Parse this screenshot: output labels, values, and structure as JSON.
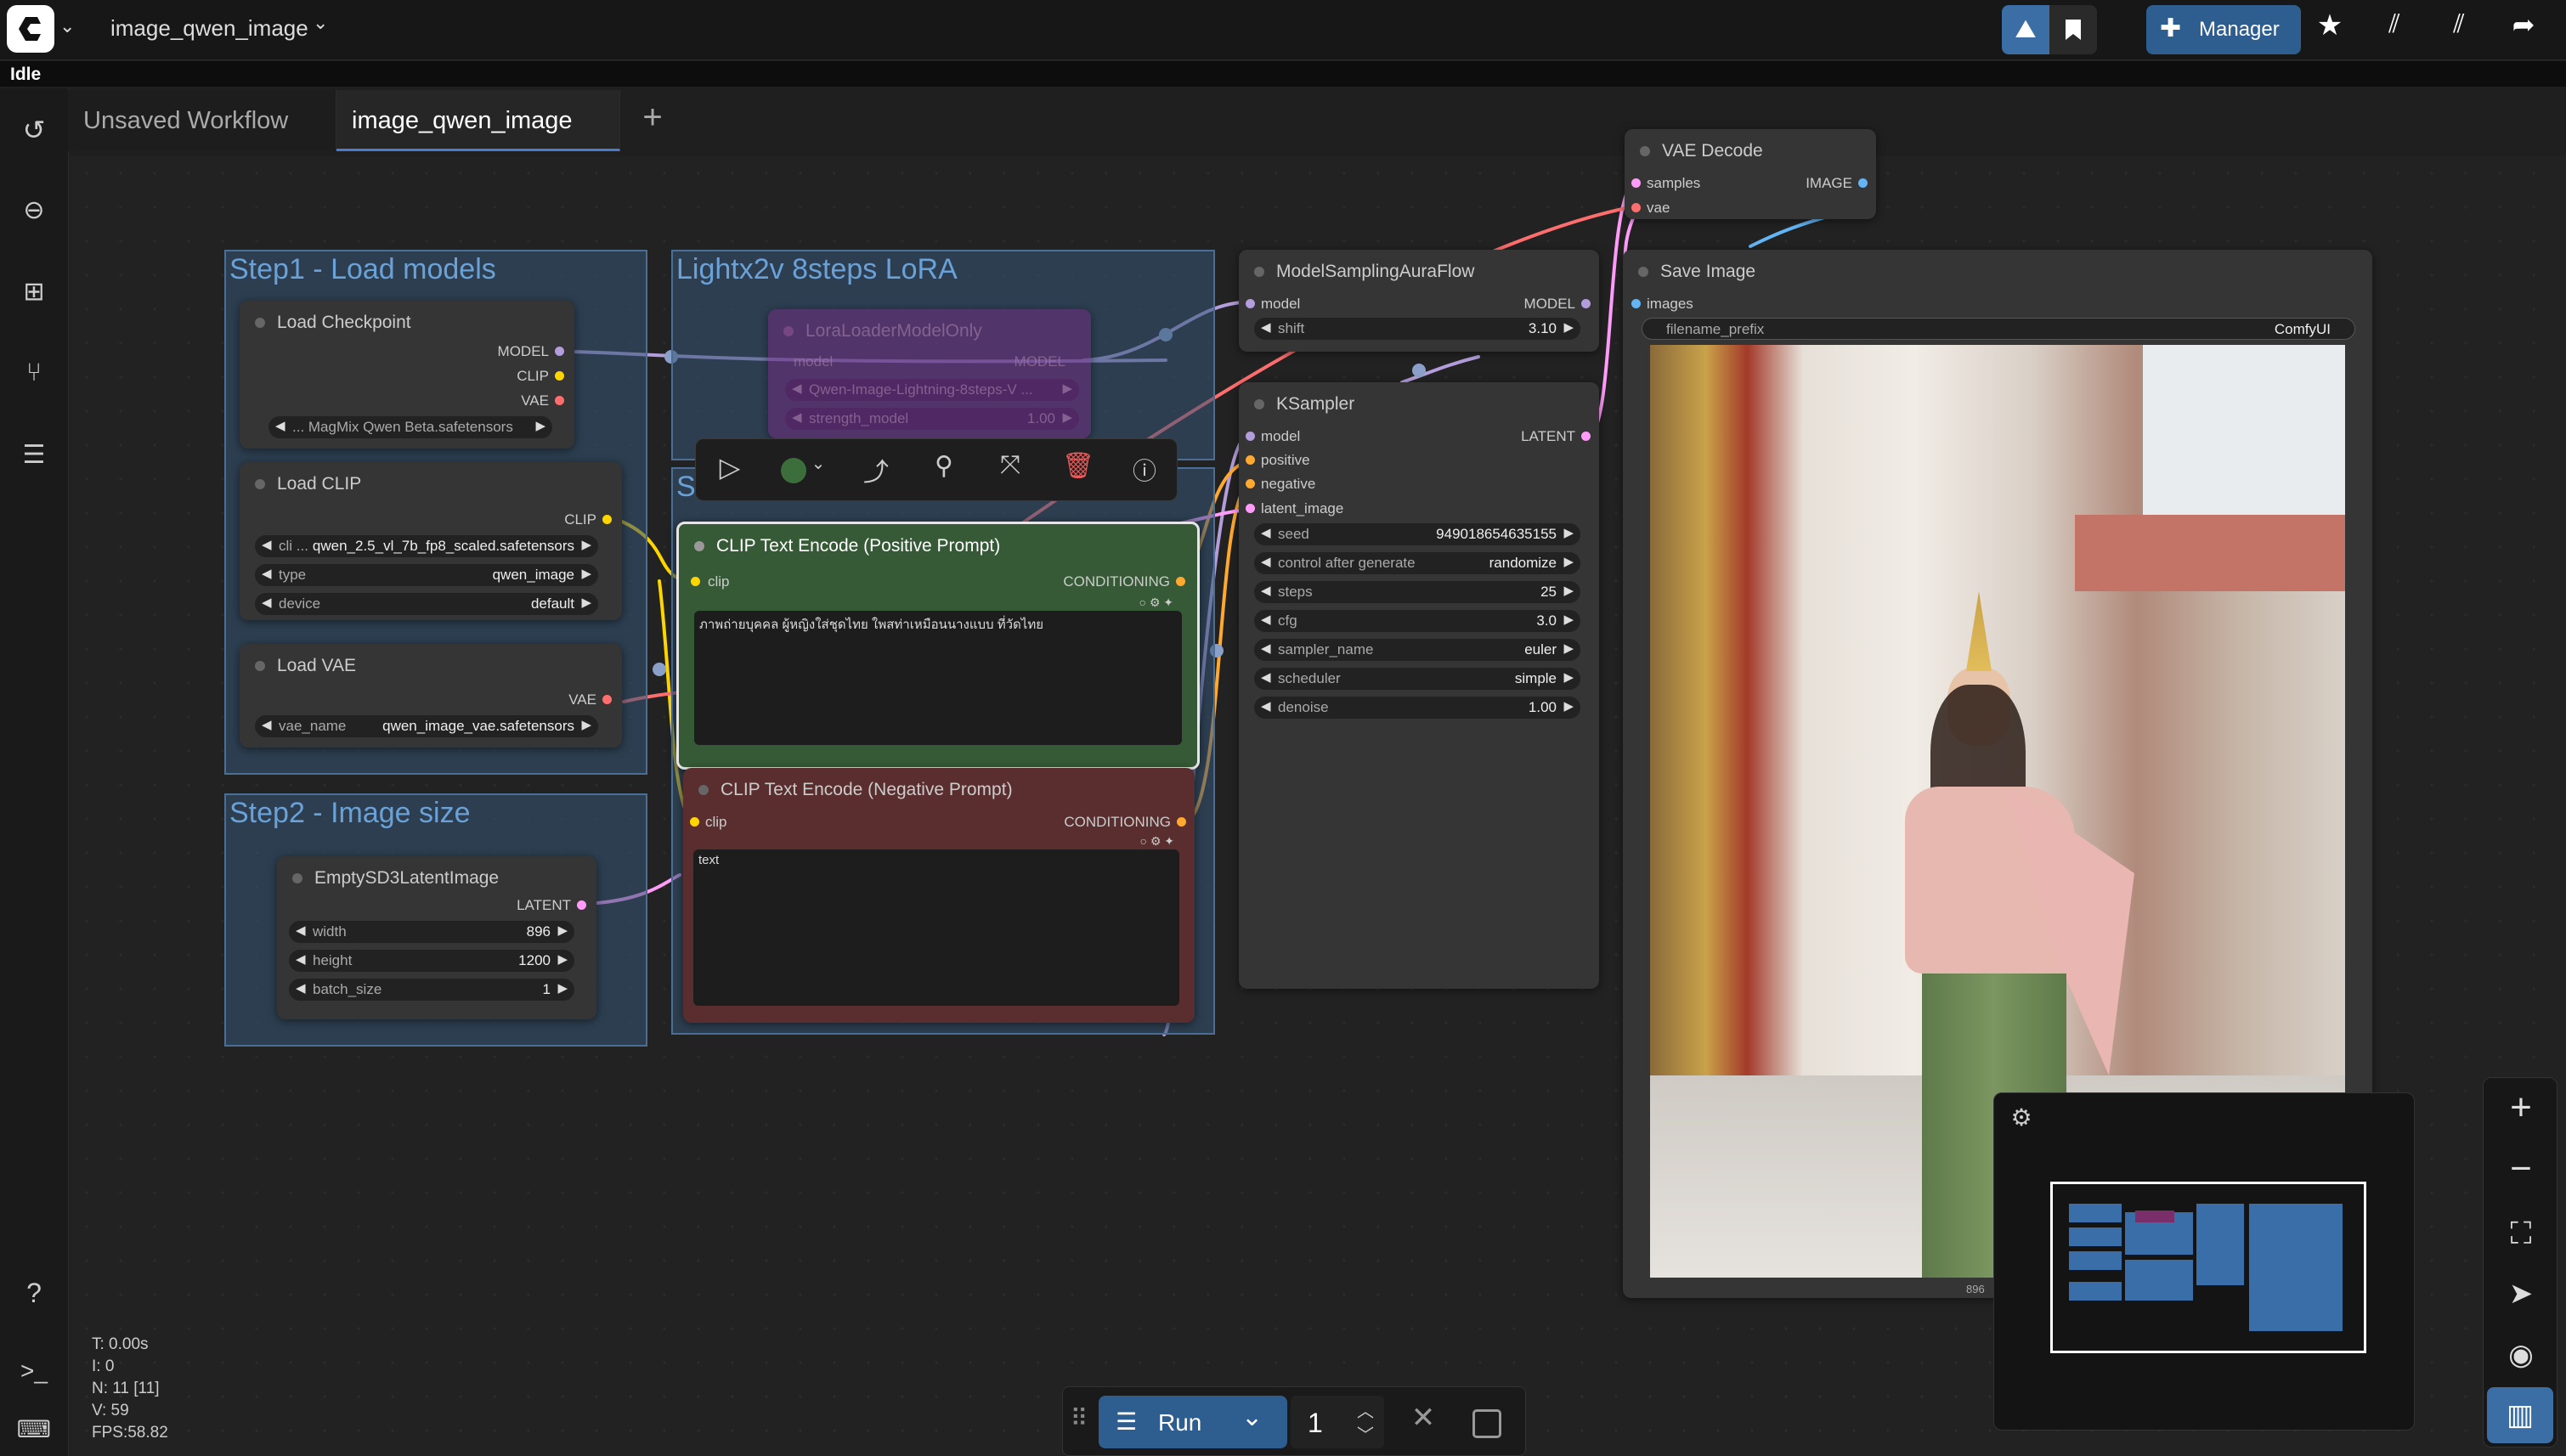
{
  "app": {
    "workflow_name": "image_qwen_image",
    "status": "Idle",
    "header_buttons": {
      "manager": "Manager"
    }
  },
  "tabs": [
    {
      "label": "Unsaved Workflow"
    },
    {
      "label": "image_qwen_image"
    }
  ],
  "groups": {
    "step1": "Step1 - Load models",
    "lora": "Lightx2v 8steps LoRA",
    "step2": "Step2 - Image size",
    "prompt_group": "S"
  },
  "nodes": {
    "load_checkpoint": {
      "title": "Load Checkpoint",
      "outputs": [
        "MODEL",
        "CLIP",
        "VAE"
      ],
      "ckpt_value": "... MagMix Qwen Beta.safetensors"
    },
    "load_clip": {
      "title": "Load CLIP",
      "output": "CLIP",
      "widgets": [
        {
          "label": "cli ...",
          "value": "qwen_2.5_vl_7b_fp8_scaled.safetensors"
        },
        {
          "label": "type",
          "value": "qwen_image"
        },
        {
          "label": "device",
          "value": "default"
        }
      ]
    },
    "load_vae": {
      "title": "Load VAE",
      "output": "VAE",
      "widget": {
        "label": "vae_name",
        "value": "qwen_image_vae.safetensors"
      }
    },
    "empty_latent": {
      "title": "EmptySD3LatentImage",
      "output": "LATENT",
      "widgets": [
        {
          "label": "width",
          "value": "896"
        },
        {
          "label": "height",
          "value": "1200"
        },
        {
          "label": "batch_size",
          "value": "1"
        }
      ]
    },
    "lora_loader": {
      "title": "LoraLoaderModelOnly",
      "input": "model",
      "output": "MODEL",
      "widgets": [
        {
          "label": "",
          "value": "Qwen-Image-Lightning-8steps-V ..."
        },
        {
          "label": "strength_model",
          "value": "1.00"
        }
      ]
    },
    "positive": {
      "title": "CLIP Text Encode (Positive Prompt)",
      "input": "clip",
      "output": "CONDITIONING",
      "text": "ภาพถ่ายบุคคล ผู้หญิงใส่ชุดไทย ใพสท่าเหมือนนางแบบ ที่วัดไทย"
    },
    "negative": {
      "title": "CLIP Text Encode (Negative Prompt)",
      "input": "clip",
      "output": "CONDITIONING",
      "text": "text"
    },
    "model_sampling": {
      "title": "ModelSamplingAuraFlow",
      "input": "model",
      "output": "MODEL",
      "widget": {
        "label": "shift",
        "value": "3.10"
      }
    },
    "ksampler": {
      "title": "KSampler",
      "inputs": [
        "model",
        "positive",
        "negative",
        "latent_image"
      ],
      "output": "LATENT",
      "widgets": [
        {
          "label": "seed",
          "value": "949018654635155"
        },
        {
          "label": "control after generate",
          "value": "randomize"
        },
        {
          "label": "steps",
          "value": "25"
        },
        {
          "label": "cfg",
          "value": "3.0"
        },
        {
          "label": "sampler_name",
          "value": "euler"
        },
        {
          "label": "scheduler",
          "value": "simple"
        },
        {
          "label": "denoise",
          "value": "1.00"
        }
      ]
    },
    "vae_decode": {
      "title": "VAE Decode",
      "inputs": [
        "samples",
        "vae"
      ],
      "output": "IMAGE"
    },
    "save_image": {
      "title": "Save Image",
      "input": "images",
      "widget": {
        "label": "filename_prefix",
        "value": "ComfyUI"
      },
      "image_width_label": "896"
    }
  },
  "stats": {
    "t": "T: 0.00s",
    "i": "I: 0",
    "n": "N: 11 [11]",
    "v": "V: 59",
    "fps": "FPS:58.82"
  },
  "run_bar": {
    "run_label": "Run",
    "batch_count": "1"
  },
  "colors": {
    "model": "#b39ddb",
    "clip": "#ffd500",
    "vae": "#ff6e6e",
    "latent": "#ff9cf9",
    "conditioning": "#ffa931",
    "image": "#64b5f6",
    "accent": "#2e5e8f"
  }
}
